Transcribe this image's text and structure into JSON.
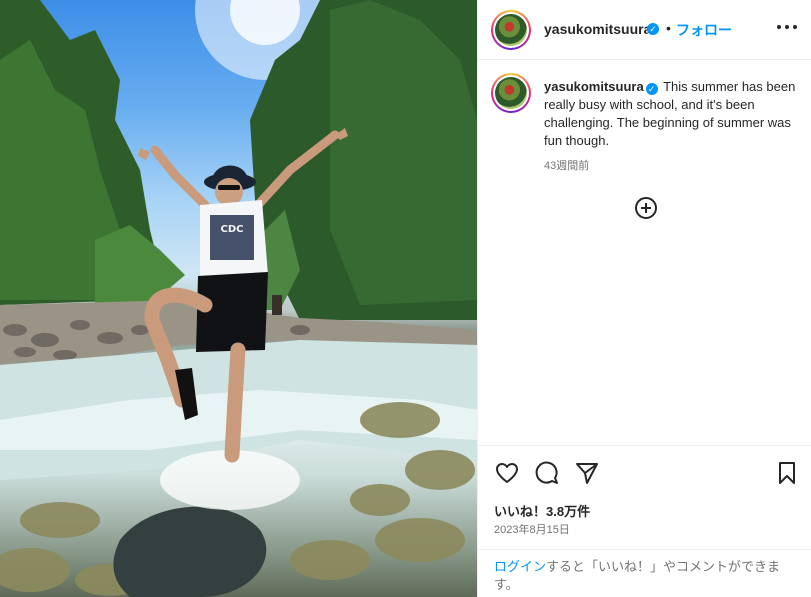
{
  "post": {
    "username": "yasukomitsuura",
    "verified_mark": "✓",
    "separator": "•",
    "follow_label": "フォロー",
    "caption_text": "This summer has been really busy with school, and it's been challenging. The beginning of summer was fun though.",
    "posted_ago": "43週間前",
    "likes": "いいね！3.8万件",
    "date": "2023年8月15日"
  },
  "comment_prompt": {
    "login_label": "ログイン",
    "rest": "すると「いいね！」やコメントができます。"
  },
  "icons": {
    "more": "more-options-icon",
    "add_comment": "add-circle-icon",
    "like": "heart-icon",
    "comment": "comment-icon",
    "share": "share-icon",
    "save": "bookmark-icon"
  },
  "colors": {
    "accent": "#0095f6",
    "text": "#262626",
    "muted": "#737373"
  }
}
